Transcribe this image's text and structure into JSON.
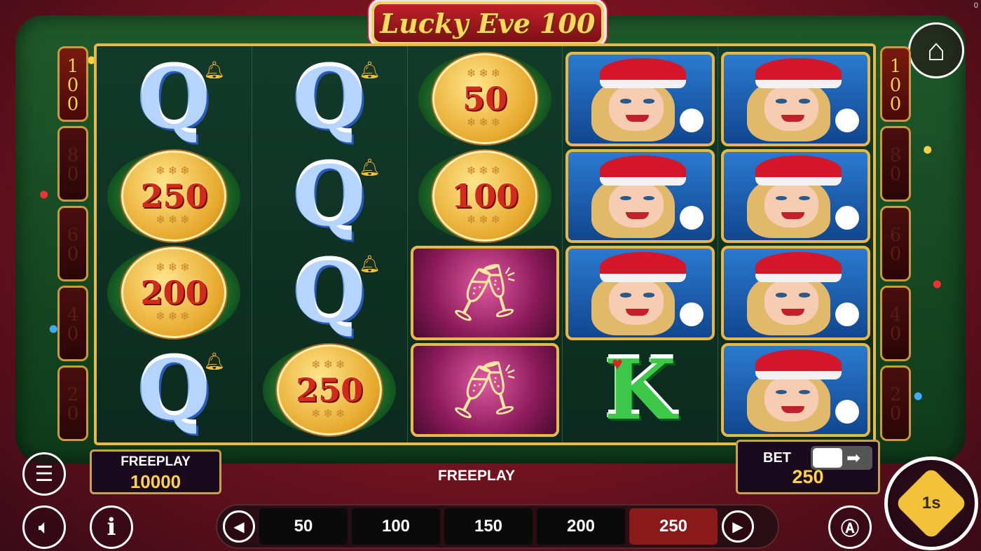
{
  "corner_text": "0",
  "title": "Lucky Eve 100",
  "meter": [
    "100",
    "80",
    "60",
    "40",
    "20"
  ],
  "reels": [
    [
      {
        "type": "letter",
        "value": "Q"
      },
      {
        "type": "coin",
        "value": "250"
      },
      {
        "type": "coin",
        "value": "200"
      },
      {
        "type": "letter",
        "value": "Q"
      }
    ],
    [
      {
        "type": "letter",
        "value": "Q"
      },
      {
        "type": "letter",
        "value": "Q"
      },
      {
        "type": "letter",
        "value": "Q"
      },
      {
        "type": "coin",
        "value": "250"
      }
    ],
    [
      {
        "type": "coin",
        "value": "50"
      },
      {
        "type": "coin",
        "value": "100"
      },
      {
        "type": "champagne"
      },
      {
        "type": "champagne"
      }
    ],
    [
      {
        "type": "lady"
      },
      {
        "type": "lady"
      },
      {
        "type": "lady"
      },
      {
        "type": "letter",
        "value": "K"
      }
    ],
    [
      {
        "type": "lady"
      },
      {
        "type": "lady"
      },
      {
        "type": "lady"
      },
      {
        "type": "lady"
      }
    ]
  ],
  "freeplay_box": {
    "label": "FREEPLAY",
    "value": "10000"
  },
  "status": "FREEPLAY",
  "bet_box": {
    "label": "BET",
    "value": "250"
  },
  "bet_options": [
    "50",
    "100",
    "150",
    "200",
    "250"
  ],
  "selected_bet": "250",
  "icons": {
    "menu": "hamburger-icon",
    "sound": "speaker-icon",
    "info": "info-icon",
    "home": "home-icon",
    "auto": "autoplay-icon",
    "spin": "spin-icon",
    "prev": "chevron-left-icon",
    "next": "chevron-right-icon"
  },
  "colors": {
    "gold": "#ffd24a",
    "selected_bet": "#8a1a1a"
  }
}
